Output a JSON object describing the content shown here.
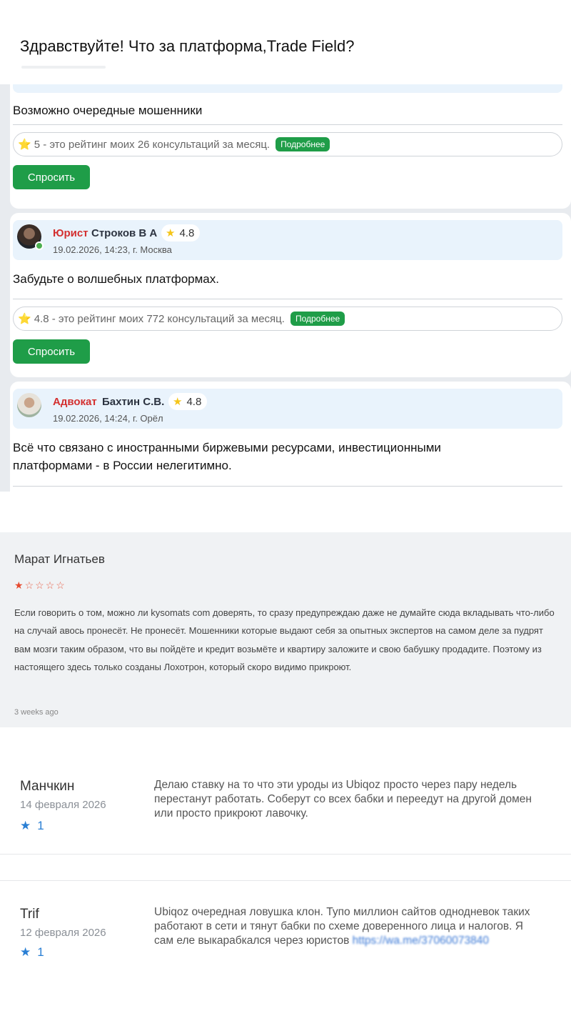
{
  "question": {
    "title": "Здравствуйте! Что за платформа,Trade Field?"
  },
  "answers": [
    {
      "text": "Возможно очередные мошенники",
      "rating_prefix": "⭐",
      "rating_line": "5 - это рейтинг моих 26 консультаций за месяц.",
      "details_label": "Подробнее",
      "ask_label": "Спросить"
    },
    {
      "role": "Юрист",
      "name": "Строков В А",
      "rating": "4.8",
      "date_place": "19.02.2026, 14:23,  г. Москва",
      "text": "Забудьте о волшебных платформах.",
      "rating_prefix": "⭐",
      "rating_line": "4.8 - это рейтинг моих 772 консультаций за месяц.",
      "details_label": "Подробнее",
      "ask_label": "Спросить"
    },
    {
      "role": "Адвокат",
      "name": "Бахтин С.В.",
      "rating": "4.8",
      "date_place": "19.02.2026, 14:24,  г. Орёл",
      "text": "Всё что связано с иностранными биржевыми ресурсами, инвестиционными платформами - в России нелегитимно."
    }
  ],
  "review": {
    "author": "Марат Игнатьев",
    "stars_filled": 1,
    "stars_total": 5,
    "text": "Если говорить о том, можно ли kysomats com доверять, то сразу предупреждаю даже не думайте сюда вкладывать что-либо на случай авось пронесёт. Не пронесёт. Мошенники которые выдают себя за опытных экспертов на самом деле за пудрят вам мозги таким образом, что вы пойдёте и кредит возьмёте и квартиру заложите и свою бабушку продадите. Поэтому из настоящего здесь только созданы Лохотрон, который скоро видимо прикроют.",
    "time": "3 weeks ago",
    "star_color": "#e64a2e"
  },
  "comments": [
    {
      "author": "Манчкин",
      "date": "14 февраля 2026",
      "likes": "1",
      "text": "Делаю ставку на то что эти уроды из Ubiqoz просто через пару недель перестанут работать. Соберут со всех бабки и переедут на другой домен или просто прикроют лавочку."
    },
    {
      "author": "Trif",
      "date": "12 февраля 2026",
      "likes": "1",
      "text": "Ubiqoz очередная ловушка клон. Тупо миллион сайтов однодневок таких работают в сети и тянут бабки по схеме доверенного лица и налогов. Я сам еле выкарабкался через юристов",
      "link": "https://wa.me/37060073840"
    }
  ],
  "colors": {
    "accent_green": "#1f9d48",
    "role_red": "#d32f2f",
    "author_bar": "#e9f3fc",
    "like_blue": "#2a7fd4"
  },
  "icons": {
    "rating": "star-icon",
    "like": "star-icon"
  }
}
